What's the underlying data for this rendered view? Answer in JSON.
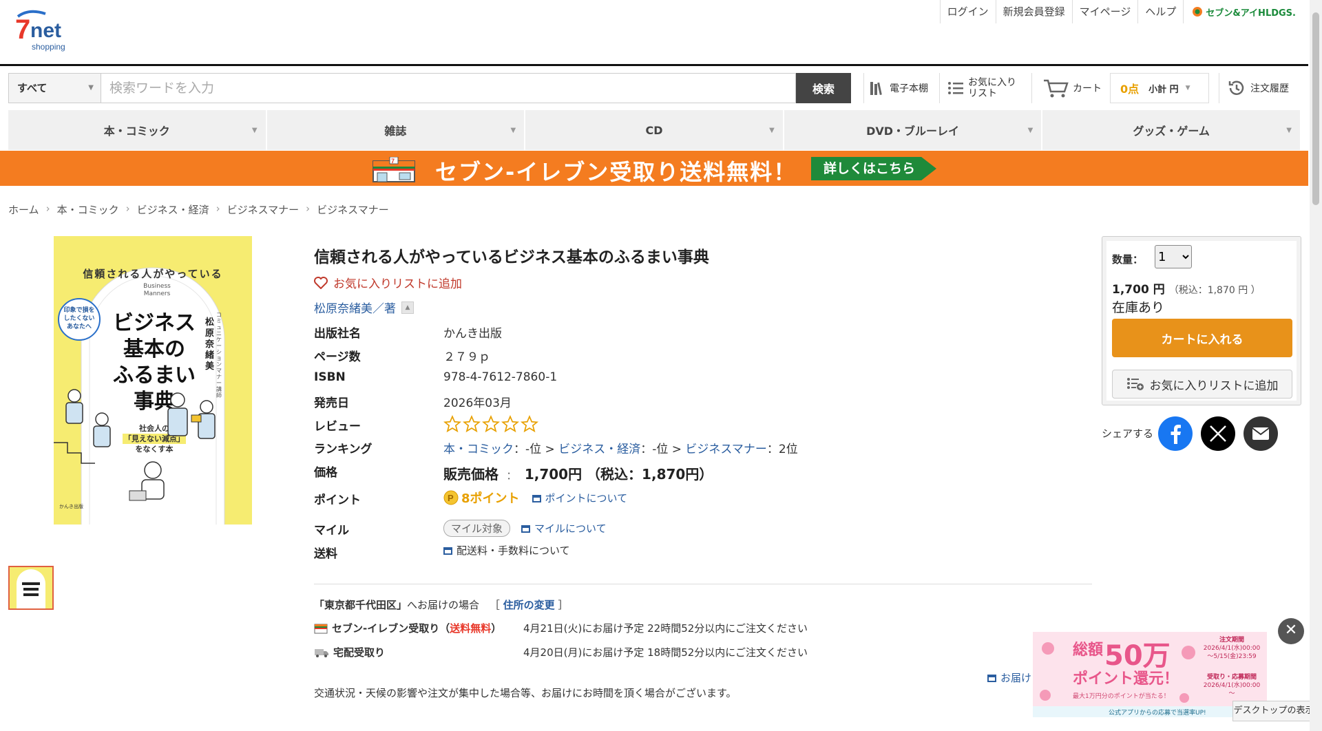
{
  "header": {
    "logo_text": "7net shopping",
    "top_links": [
      "ログイン",
      "新規会員登録",
      "マイページ",
      "ヘルプ"
    ],
    "holdings_text": "セブン&アイHLDGS."
  },
  "search": {
    "category": "すべて",
    "placeholder": "検索ワードを入力",
    "button": "検索"
  },
  "header_tools": {
    "ebook": "電子本棚",
    "favorites": "お気に入りリスト",
    "cart": "カート",
    "points": "0点",
    "subtotal": "小計 円",
    "order_history": "注文履歴"
  },
  "category_nav": [
    "本・コミック",
    "雑誌",
    "CD",
    "DVD・ブルーレイ",
    "グッズ・ゲーム"
  ],
  "banner": {
    "text": "セブン-イレブン受取り送料無料！",
    "cta": "詳しくはこちら"
  },
  "breadcrumb": [
    "ホーム",
    "本・コミック",
    "ビジネス・経済",
    "ビジネスマナー",
    "ビジネスマナー"
  ],
  "cover": {
    "top_arc": "信頼される人がやっている",
    "subtitle_en": "Business Manners",
    "side_badge": "印象で損をしたくないあなたへ",
    "main_title": [
      "ビジネス",
      "基本の",
      "ふるまい",
      "事典"
    ],
    "tagline": [
      "社会人の",
      "「見えない減点」",
      "をなくす本"
    ],
    "author_vertical": "松原奈緒美",
    "author_role": "コミュニケーションマナー講師",
    "publisher_mark": "かんき出版"
  },
  "product": {
    "title": "信頼される人がやっているビジネス基本のふるまい事典",
    "fav_link": "お気に入りリストに追加",
    "author": "松原奈緒美／著",
    "rows": {
      "publisher_label": "出版社名",
      "publisher": "かんき出版",
      "pages_label": "ページ数",
      "pages": "２７９ｐ",
      "isbn_label": "ISBN",
      "isbn": "978-4-7612-7860-1",
      "release_label": "発売日",
      "release": "2026年03月",
      "review_label": "レビュー",
      "ranking_label": "ランキング",
      "ranking": [
        {
          "name": "本・コミック",
          "rank": "：-位"
        },
        {
          "name": "ビジネス・経済",
          "rank": "：-位"
        },
        {
          "name": "ビジネスマナー",
          "rank": "：2位"
        }
      ],
      "ranking_sep": ">",
      "price_label": "価格",
      "price_prefix": "販売価格",
      "price_colon": "：",
      "price": "1,700円 （税込：1,870円）",
      "point_label": "ポイント",
      "points": "8ポイント",
      "point_about": "ポイントについて",
      "mile_label": "マイル",
      "mile_badge": "マイル対象",
      "mile_about": "マイルについて",
      "shipping_label": "送料",
      "shipping_about": "配送料・手数料について"
    },
    "review_stars_filled": 0,
    "review_stars_total": 5
  },
  "delivery": {
    "area": "「東京都千代田区」",
    "area_suffix": "へお届けの場合",
    "bracket_open": "［",
    "change": "住所の変更",
    "bracket_close": "］",
    "seven_name": "セブン-イレブン受取り（",
    "seven_free": "送料無料",
    "seven_close": "）",
    "seven_eta": "4月21日(火)にお届け予定 22時間52分以内にご注文ください",
    "home_name": "宅配受取り",
    "home_eta": "4月20日(月)にお届け予定 18時間52分以内にご注文ください",
    "partial_link": "お届け",
    "notice": "交通状況・天候の影響や注文が集中した場合等、お届けにお時間を頂く場合がございます。"
  },
  "buybox": {
    "qty_label": "数量：",
    "qty_value": "1",
    "price": "1,700 円",
    "tax": "（税込：1,870 円 ）",
    "stock": "在庫あり",
    "add_cart": "カートに入れる",
    "add_fav": "お気に入りリストに追加"
  },
  "share": {
    "label": "シェアする"
  },
  "ad": {
    "headline_1": "総額",
    "headline_num": "50万",
    "headline_2": "ポイント還元！",
    "sub": "最大1万円分のポイントが当たる！",
    "period_1_label": "注文期間",
    "period_1": "2026/4/1(水)00:00～5/15(金)23:59",
    "period_2_label": "受取り・応募期間",
    "period_2": "2026/4/1(水)00:00～",
    "footer": "公式アプリからの応募で当選率UP!",
    "desktop": "デスクトップの表示"
  },
  "colors": {
    "brand_orange": "#f47c20",
    "cta_green": "#1f8a3a",
    "cart_button": "#e8921a",
    "link_blue": "#2a5d9f",
    "facebook": "#1877f2"
  }
}
